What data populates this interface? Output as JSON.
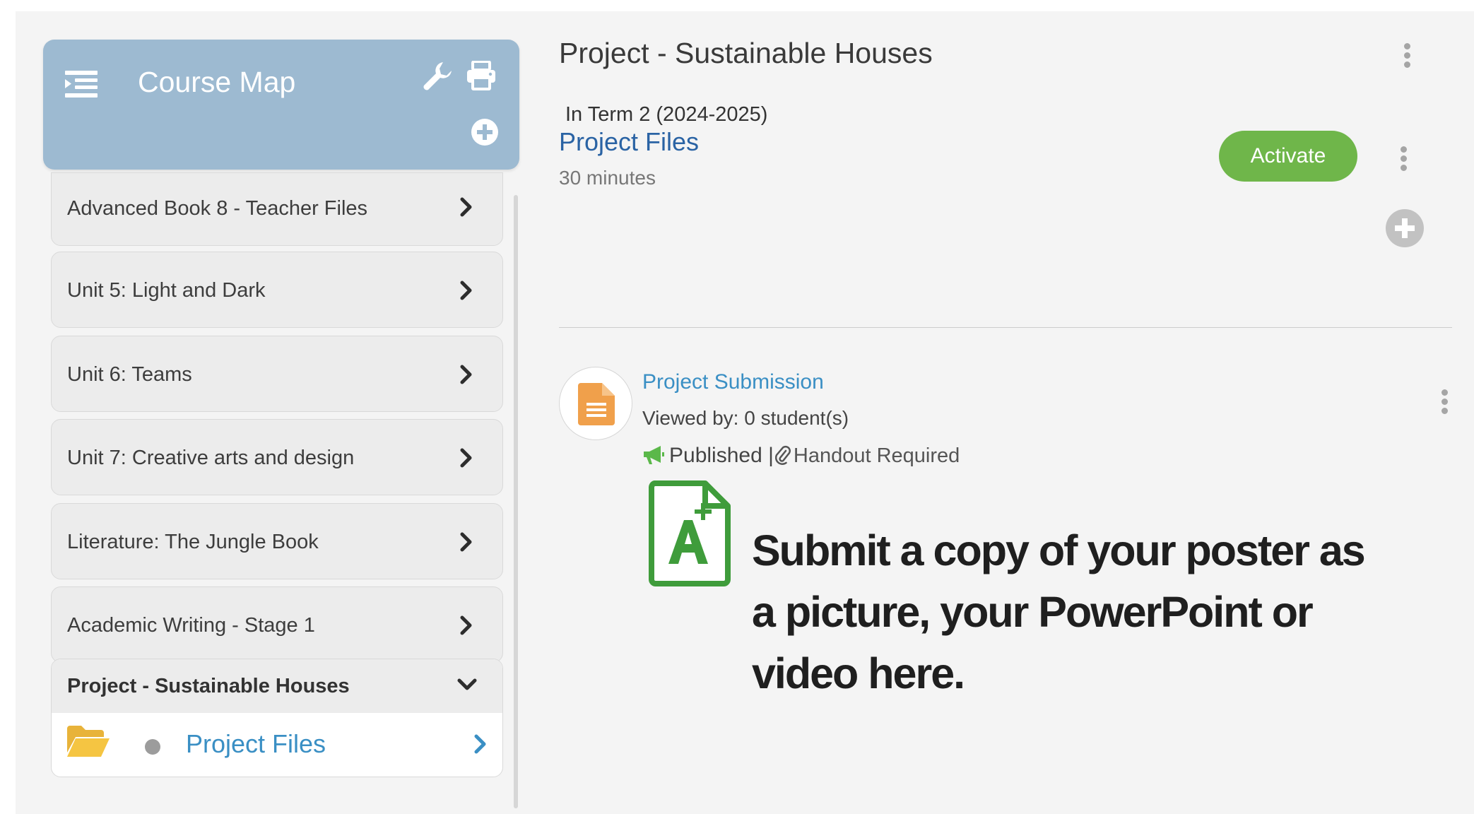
{
  "sidebar": {
    "title": "Course Map",
    "icons": {
      "menu": "list-menu-icon",
      "settings": "wrench-icon",
      "print": "printer-icon",
      "add": "plus-circle-icon"
    },
    "items": [
      {
        "label": "Advanced Book 8 - Teacher Files"
      },
      {
        "label": "Unit 5: Light and Dark"
      },
      {
        "label": "Unit 6: Teams"
      },
      {
        "label": "Unit 7: Creative arts and design"
      },
      {
        "label": "Literature: The Jungle Book"
      },
      {
        "label": "Academic Writing - Stage 1"
      }
    ],
    "active": {
      "label": "Project - Sustainable Houses",
      "sub_label": "Project Files"
    }
  },
  "main": {
    "title": "Project - Sustainable Houses",
    "term": "In Term 2 (2024-2025)",
    "resource_title": "Project Files",
    "duration": "30 minutes",
    "activate_label": "Activate",
    "assignment": {
      "title": "Project Submission",
      "viewed": "Viewed by: 0 student(s)",
      "status": "Published",
      "separator": "|",
      "handout": "Handout Required",
      "instruction": "Submit a copy of your poster as a picture, your PowerPoint or video here."
    }
  },
  "colors": {
    "header_bg": "#9dbad1",
    "activate_green": "#6fb64a",
    "link_blue": "#3a8fc4",
    "title_blue": "#2a63a4",
    "doc_orange": "#f0a04b",
    "doc_green": "#3f9c3b"
  }
}
